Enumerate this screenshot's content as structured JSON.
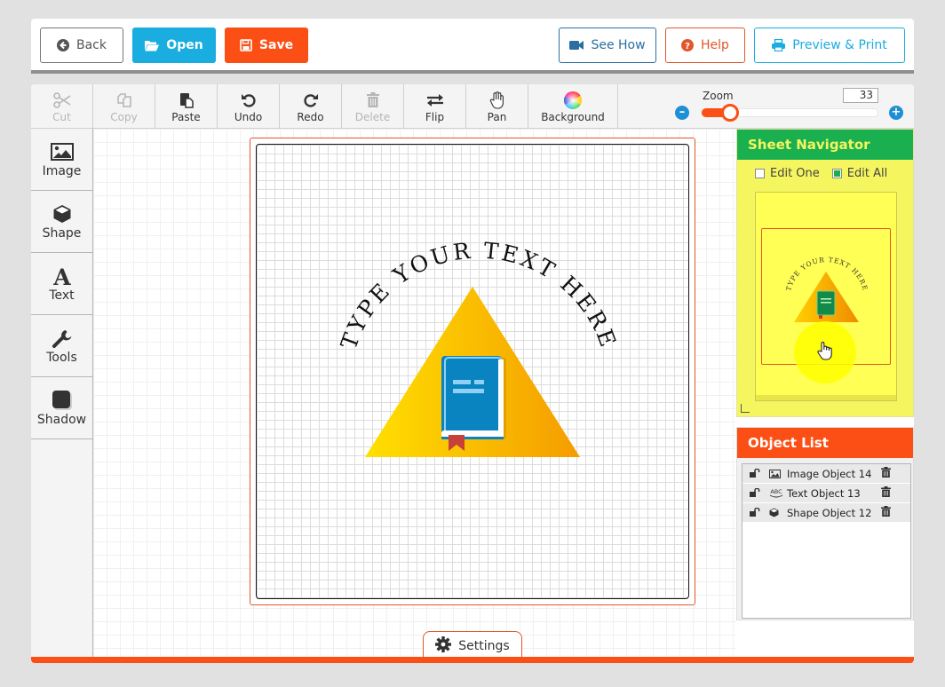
{
  "topbar": {
    "back": "Back",
    "open": "Open",
    "save": "Save",
    "see_how": "See How",
    "help": "Help",
    "preview_print": "Preview & Print"
  },
  "toolbar": {
    "cut": "Cut",
    "copy": "Copy",
    "paste": "Paste",
    "undo": "Undo",
    "redo": "Redo",
    "delete": "Delete",
    "flip": "Flip",
    "pan": "Pan",
    "background": "Background",
    "zoom_label": "Zoom",
    "zoom_value": "33",
    "zoom_fraction": 0.16
  },
  "sidebar": {
    "items": [
      {
        "label": "Image",
        "icon": "image-icon"
      },
      {
        "label": "Shape",
        "icon": "cube-icon"
      },
      {
        "label": "Text",
        "icon": "text-icon"
      },
      {
        "label": "Tools",
        "icon": "wrench-icon"
      },
      {
        "label": "Shadow",
        "icon": "shadow-icon"
      }
    ]
  },
  "canvas": {
    "curved_text": "TYPE YOUR TEXT HERE",
    "colors": {
      "triangle_start": "#ffe000",
      "triangle_end": "#f59c00",
      "book": "#0a84c1",
      "book_light": "#8fd1f2",
      "bookmark": "#c8403a"
    }
  },
  "settings": {
    "label": "Settings"
  },
  "navigator": {
    "title": "Sheet Navigator",
    "edit_one": "Edit One",
    "edit_all": "Edit All",
    "edit_one_checked": false,
    "edit_all_checked": true,
    "preview_text": "TYPE YOUR TEXT HERE"
  },
  "object_list": {
    "title": "Object List",
    "items": [
      {
        "name": "Image Object 14",
        "type": "image"
      },
      {
        "name": "Text Object 13",
        "type": "text"
      },
      {
        "name": "Shape Object 12",
        "type": "shape"
      }
    ]
  },
  "colors": {
    "accent_orange": "#fb4f15",
    "accent_blue": "#1aaddf",
    "navigator_green": "#1ab04f",
    "navigator_yellow": "#f5f560"
  }
}
